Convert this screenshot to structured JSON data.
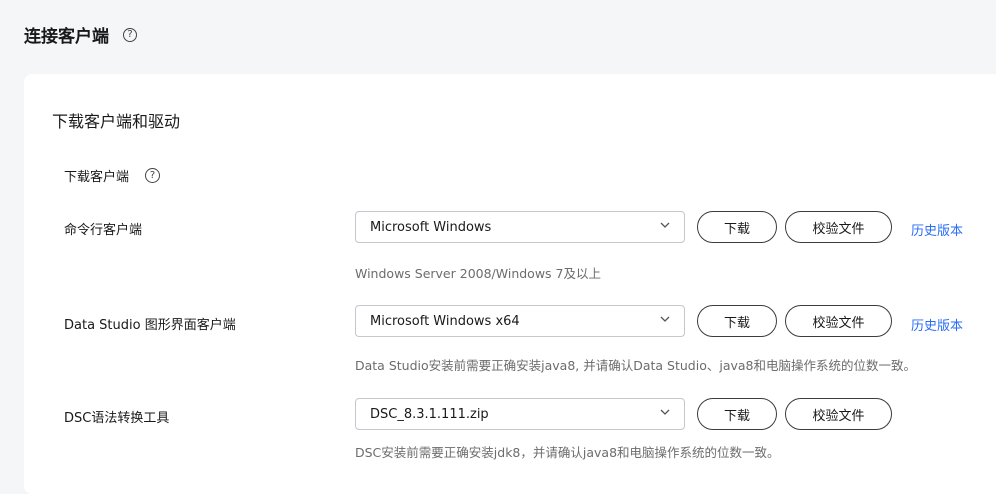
{
  "page": {
    "title": "连接客户端"
  },
  "section": {
    "title": "下载客户端和驱动"
  },
  "sub_header": {
    "label": "下载客户端"
  },
  "buttons": {
    "download": "下载",
    "verify": "校验文件",
    "history": "历史版本"
  },
  "rows": [
    {
      "label": "命令行客户端",
      "selected": "Microsoft Windows",
      "hint": "Windows Server 2008/Windows 7及以上",
      "show_history": true
    },
    {
      "label": "Data Studio 图形界面客户端",
      "selected": "Microsoft Windows x64",
      "hint": "Data Studio安装前需要正确安装java8, 并请确认Data Studio、java8和电脑操作系统的位数一致。",
      "show_history": true
    },
    {
      "label": "DSC语法转换工具",
      "selected": "DSC_8.3.1.111.zip",
      "hint": "DSC安装前需要正确安装jdk8，并请确认java8和电脑操作系统的位数一致。",
      "show_history": false
    }
  ],
  "icons": {
    "help": "help-circle-icon",
    "dropdown": "chevron-down-icon"
  },
  "colors": {
    "link": "#2a6df4",
    "background": "#f5f6f8",
    "card": "#ffffff"
  }
}
